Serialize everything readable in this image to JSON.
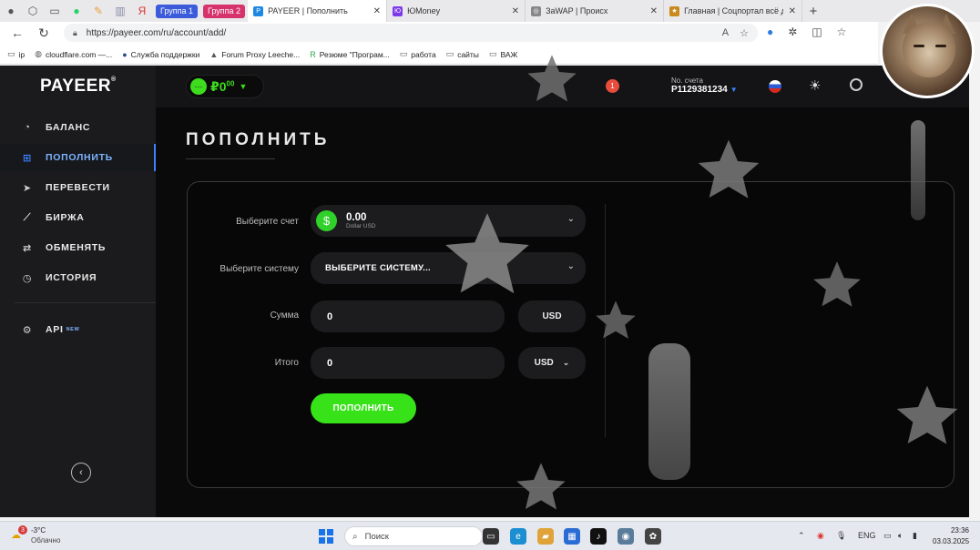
{
  "browser": {
    "tab_groups": [
      {
        "label": "Группа 1",
        "color": "#3b5bdb"
      },
      {
        "label": "Группа 2",
        "color": "#d6336c"
      }
    ],
    "tabs": [
      {
        "title": "PAYEER | Пополнить",
        "active": true
      },
      {
        "title": "ЮMoney"
      },
      {
        "title": "ЗаWAP | Происх"
      },
      {
        "title": "Главная | Соцпортал всё для"
      }
    ],
    "url": "https://payeer.com/ru/account/add/",
    "bookmarks": [
      "ip",
      "cloudflare.com —...",
      "Служба поддержки",
      "Forum Proxy Leeche...",
      "Резюме \"Програм...",
      "работа",
      "сайты",
      "ВАЖ"
    ]
  },
  "app": {
    "logo": "PAYEER",
    "logo_reg": "®",
    "balance": {
      "symbol": "₽",
      "amount": "0",
      "fraction": "00"
    },
    "notifications": "1",
    "account_label": "No. счета",
    "account_number": "P1129381234",
    "menu": [
      {
        "label": "БАЛАНС",
        "icon": "gauge-icon"
      },
      {
        "label": "ПОПОЛНИТЬ",
        "icon": "plus-square-icon",
        "active": true
      },
      {
        "label": "ПЕРЕВЕСТИ",
        "icon": "send-icon"
      },
      {
        "label": "БИРЖА",
        "icon": "chart-icon"
      },
      {
        "label": "ОБМЕНЯТЬ",
        "icon": "exchange-icon"
      },
      {
        "label": "ИСТОРИЯ",
        "icon": "clock-icon"
      }
    ],
    "api_label": "API",
    "api_badge": "NEW",
    "accent": "#3c82ff",
    "brand_green": "#37e219"
  },
  "form": {
    "title": "ПОПОЛНИТЬ",
    "account_label": "Выберите счет",
    "account_amount": "0.00",
    "account_currency": "Dollar USD",
    "system_label": "Выберите систему",
    "system_value": "ВЫБЕРИТЕ СИСТЕМУ...",
    "sum_label": "Сумма",
    "sum_value": "0",
    "sum_currency": "USD",
    "total_label": "Итого",
    "total_value": "0",
    "total_currency": "USD",
    "submit_label": "ПОПОЛНИТЬ"
  },
  "taskbar": {
    "weather_temp": "-3°C",
    "weather_desc": "Облачно",
    "weather_badge": "3",
    "search_placeholder": "Поиск",
    "lang": "ENG",
    "time": "23:36",
    "date": "03.03.2025"
  }
}
